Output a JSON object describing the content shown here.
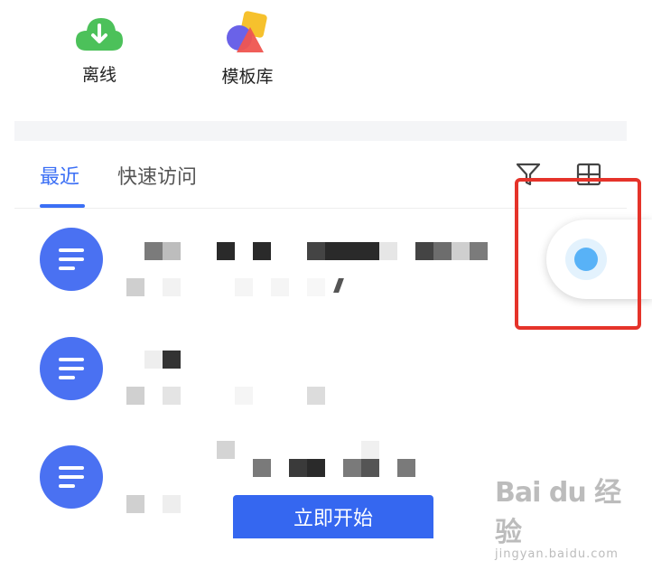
{
  "quick_access": [
    {
      "label": "离线",
      "icon": "download-cloud-icon"
    },
    {
      "label": "模板库",
      "icon": "shapes-icon"
    }
  ],
  "tabs": [
    {
      "label": "最近",
      "active": true
    },
    {
      "label": "快速访问",
      "active": false
    }
  ],
  "toolbar_icons": [
    "filter-icon",
    "grid-view-icon"
  ],
  "file_list_row_count": 3,
  "bottom_button_label": "立即开始",
  "watermark": {
    "main": "Bai du 经验",
    "sub": "jingyan.baidu.com"
  },
  "colors": {
    "accent": "#3b6ff5",
    "doc_icon": "#4a71f2",
    "highlight": "#e5332a",
    "float_dot": "#58b2f7",
    "download_green": "#4cc15a"
  }
}
